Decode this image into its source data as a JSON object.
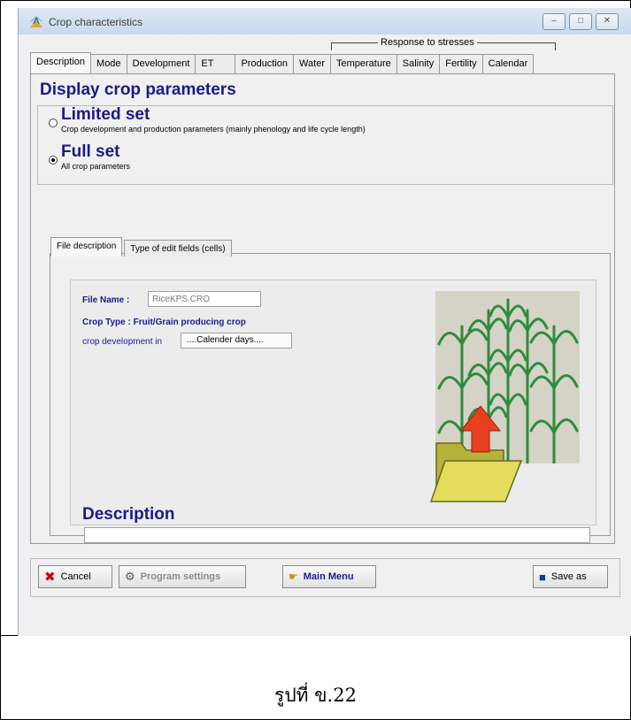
{
  "window": {
    "title": "Crop characteristics",
    "buttons": {
      "minimize": "–",
      "maximize": "□",
      "close": "✕"
    }
  },
  "stress_group_label": "Response to stresses",
  "tabs": [
    "Description",
    "Mode",
    "Development",
    "ET",
    "Production",
    "Water",
    "Temperature",
    "Salinity",
    "Fertility",
    "Calendar"
  ],
  "heading": "Display crop parameters",
  "options": {
    "limited": {
      "title": "Limited set",
      "desc": "Crop development and production parameters (mainly phenology and life cycle length)",
      "selected": false
    },
    "full": {
      "title": "Full set",
      "desc": "All crop parameters",
      "selected": true
    }
  },
  "subtabs": [
    "File description",
    "Type of edit fields (cells)"
  ],
  "file": {
    "name_label": "File Name :",
    "name_value": "RiceKPS.CRO",
    "crop_type": "Crop Type :  Fruit/Grain producing crop",
    "dev_label": "crop development in",
    "dev_value": "....Calender days...."
  },
  "description": {
    "heading": "Description",
    "value": ""
  },
  "buttons": {
    "cancel": "Cancel",
    "program_settings": "Program settings",
    "main_menu": "Main Menu",
    "save_as": "Save as"
  },
  "caption": "รูปที่ ข.22",
  "colors": {
    "accent": "#1a1a8c",
    "cancel_icon": "#cc0000"
  }
}
